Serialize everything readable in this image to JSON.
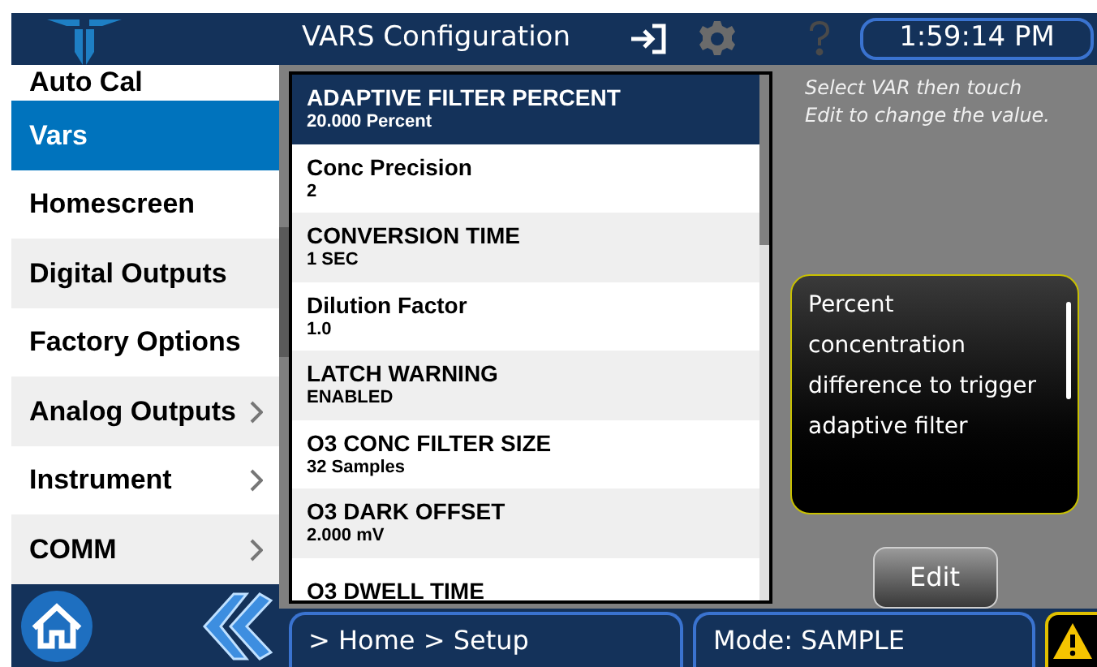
{
  "header": {
    "title": "VARS Configuration",
    "clock": "1:59:14 PM"
  },
  "sidebar": {
    "items": [
      {
        "label": "Auto Cal",
        "selected": false,
        "has_submenu": false
      },
      {
        "label": "Vars",
        "selected": true,
        "has_submenu": false
      },
      {
        "label": "Homescreen",
        "selected": false,
        "has_submenu": false
      },
      {
        "label": "Digital Outputs",
        "selected": false,
        "has_submenu": false
      },
      {
        "label": "Factory Options",
        "selected": false,
        "has_submenu": false
      },
      {
        "label": "Analog Outputs",
        "selected": false,
        "has_submenu": true
      },
      {
        "label": "Instrument",
        "selected": false,
        "has_submenu": true
      },
      {
        "label": "COMM",
        "selected": false,
        "has_submenu": true
      }
    ]
  },
  "vars": [
    {
      "name": "ADAPTIVE FILTER PERCENT",
      "value": "20.000 Percent",
      "selected": true
    },
    {
      "name": "Conc Precision",
      "value": "2",
      "selected": false
    },
    {
      "name": "CONVERSION TIME",
      "value": "1 SEC",
      "selected": false
    },
    {
      "name": "Dilution Factor",
      "value": "1.0",
      "selected": false
    },
    {
      "name": "LATCH WARNING",
      "value": "ENABLED",
      "selected": false
    },
    {
      "name": "O3 CONC FILTER SIZE",
      "value": "32 Samples",
      "selected": false
    },
    {
      "name": "O3 DARK OFFSET",
      "value": "2.000 mV",
      "selected": false
    },
    {
      "name": "O3 DWELL TIME",
      "selected": false
    }
  ],
  "hint": "Select VAR then touch Edit to change the value.",
  "description": "Percent concentration difference to trigger adaptive filter",
  "edit_button": "Edit",
  "status_bar": {
    "breadcrumb": "> Home > Setup",
    "mode": "Mode: SAMPLE"
  }
}
